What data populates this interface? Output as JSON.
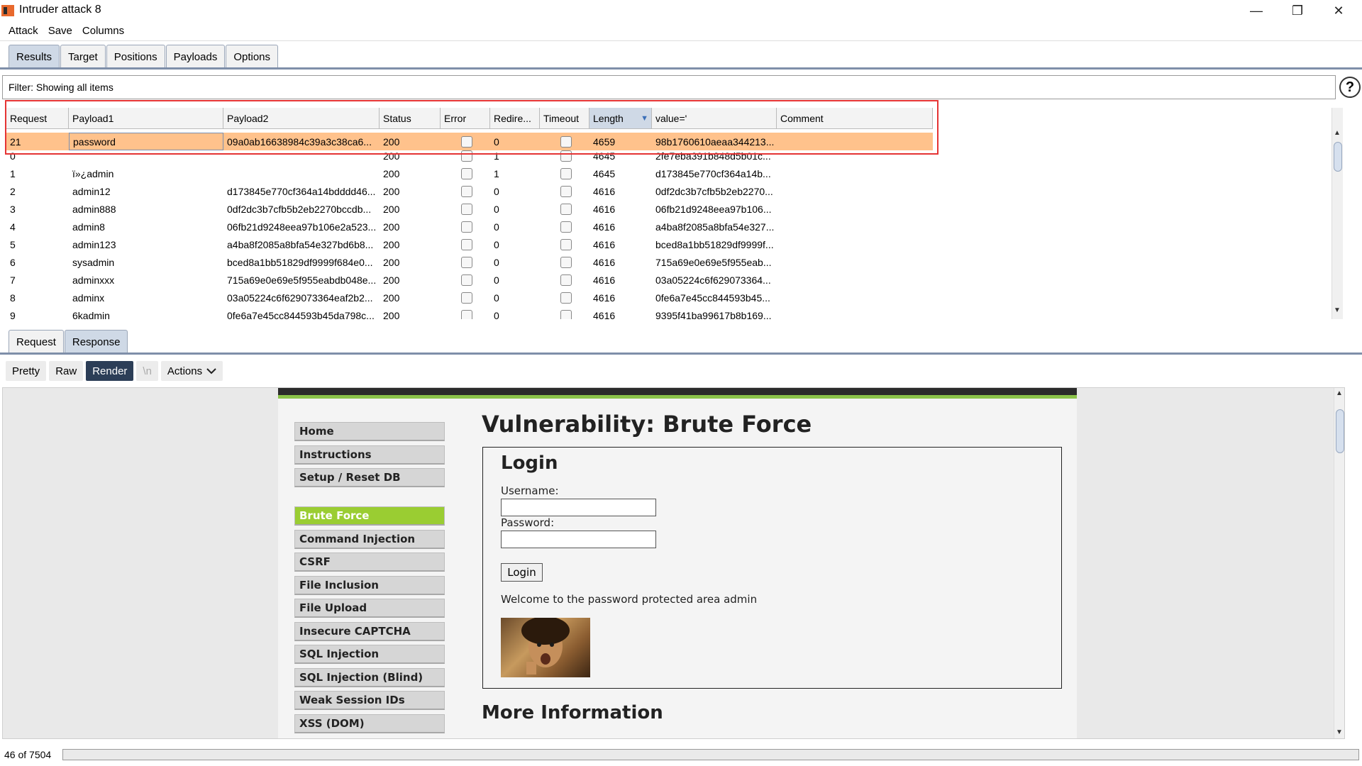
{
  "window": {
    "title": "Intruder attack 8",
    "minimize": "—",
    "maximize": "❐",
    "close": "✕"
  },
  "menu": [
    "Attack",
    "Save",
    "Columns"
  ],
  "tabs": [
    "Results",
    "Target",
    "Positions",
    "Payloads",
    "Options"
  ],
  "active_tab": "Results",
  "filter": {
    "text": "Filter:  Showing all items"
  },
  "help_icon": "?",
  "table": {
    "columns": [
      "Request",
      "Payload1",
      "Payload2",
      "Status",
      "Error",
      "Redire...",
      "Timeout",
      "Length",
      "value='",
      "Comment"
    ],
    "sorted_column": "Length",
    "sort_indicator": "▼",
    "rows": [
      {
        "request": "21",
        "payload1": "password",
        "payload2": "09a0ab16638984c39a3c38ca6...",
        "status": "200",
        "redirects": "0",
        "length": "4659",
        "value": "98b1760610aeaa344213...",
        "selected": true
      },
      {
        "request": "0",
        "payload1": "",
        "payload2": "",
        "status": "200",
        "redirects": "1",
        "length": "4645",
        "value": "2fe7eba391b848d5b01c..."
      },
      {
        "request": "1",
        "payload1": "ï»¿admin",
        "payload2": "",
        "status": "200",
        "redirects": "1",
        "length": "4645",
        "value": "d173845e770cf364a14b..."
      },
      {
        "request": "2",
        "payload1": "admin12",
        "payload2": "d173845e770cf364a14bdddd46...",
        "status": "200",
        "redirects": "0",
        "length": "4616",
        "value": "0df2dc3b7cfb5b2eb2270..."
      },
      {
        "request": "3",
        "payload1": "admin888",
        "payload2": "0df2dc3b7cfb5b2eb2270bccdb...",
        "status": "200",
        "redirects": "0",
        "length": "4616",
        "value": "06fb21d9248eea97b106..."
      },
      {
        "request": "4",
        "payload1": "admin8",
        "payload2": "06fb21d9248eea97b106e2a523...",
        "status": "200",
        "redirects": "0",
        "length": "4616",
        "value": "a4ba8f2085a8bfa54e327..."
      },
      {
        "request": "5",
        "payload1": "admin123",
        "payload2": "a4ba8f2085a8bfa54e327bd6b8...",
        "status": "200",
        "redirects": "0",
        "length": "4616",
        "value": "bced8a1bb51829df9999f..."
      },
      {
        "request": "6",
        "payload1": "sysadmin",
        "payload2": "bced8a1bb51829df9999f684e0...",
        "status": "200",
        "redirects": "0",
        "length": "4616",
        "value": "715a69e0e69e5f955eab..."
      },
      {
        "request": "7",
        "payload1": "adminxxx",
        "payload2": "715a69e0e69e5f955eabdb048e...",
        "status": "200",
        "redirects": "0",
        "length": "4616",
        "value": "03a05224c6f629073364..."
      },
      {
        "request": "8",
        "payload1": "adminx",
        "payload2": "03a05224c6f629073364eaf2b2...",
        "status": "200",
        "redirects": "0",
        "length": "4616",
        "value": "0fe6a7e45cc844593b45..."
      },
      {
        "request": "9",
        "payload1": "6kadmin",
        "payload2": "0fe6a7e45cc844593b45da798c...",
        "status": "200",
        "redirects": "0",
        "length": "4616",
        "value": "9395f41ba99617b8b169..."
      }
    ]
  },
  "rr_tabs": [
    "Request",
    "Response"
  ],
  "active_rr_tab": "Response",
  "view_buttons": [
    "Pretty",
    "Raw",
    "Render",
    "\\n",
    "Actions"
  ],
  "active_view": "Render",
  "dvwa": {
    "menu_group1": [
      "Home",
      "Instructions",
      "Setup / Reset DB"
    ],
    "menu_group2": [
      "Brute Force",
      "Command Injection",
      "CSRF",
      "File Inclusion",
      "File Upload",
      "Insecure CAPTCHA",
      "SQL Injection",
      "SQL Injection (Blind)",
      "Weak Session IDs",
      "XSS (DOM)"
    ],
    "active_item": "Brute Force",
    "title": "Vulnerability: Brute Force",
    "login_heading": "Login",
    "username_label": "Username:",
    "password_label": "Password:",
    "login_button": "Login",
    "welcome": "Welcome to the password protected area admin",
    "more_info": "More Information"
  },
  "status": {
    "count": "46 of 7504"
  },
  "colors": {
    "selected_row": "#ffc28c",
    "highlight": "#e53434",
    "dvwa_green": "#8bc34a",
    "tab_active": "#cfd9e6"
  }
}
